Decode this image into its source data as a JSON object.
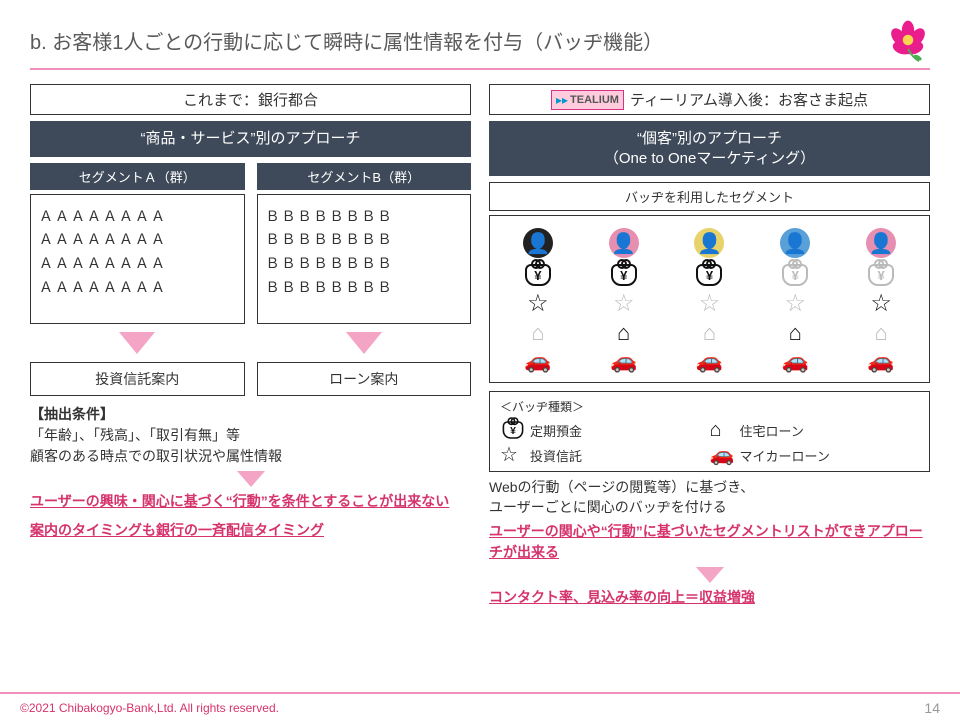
{
  "title": "b. お客様1人ごとの行動に応じて瞬時に属性情報を付与（バッヂ機能）",
  "left": {
    "header": "これまで：銀行都合",
    "approach": "“商品・サービス”別のアプローチ",
    "segments": [
      {
        "name": "セグメントＡ（群）",
        "rows": [
          "ＡＡＡＡＡＡＡＡ",
          "ＡＡＡＡＡＡＡＡ",
          "ＡＡＡＡＡＡＡＡ",
          "ＡＡＡＡＡＡＡＡ"
        ],
        "case": "投資信託案内"
      },
      {
        "name": "セグメントB（群）",
        "rows": [
          "ＢＢＢＢＢＢＢＢ",
          "ＢＢＢＢＢＢＢＢ",
          "ＢＢＢＢＢＢＢＢ",
          "ＢＢＢＢＢＢＢＢ"
        ],
        "case": "ローン案内"
      }
    ],
    "cond_title": "【抽出条件】",
    "cond_body": "「年齢」、「残高」、「取引有無」等\n顧客のある時点での取引状況や属性情報",
    "red1": "ユーザーの興味・関心に基づく“行動”を条件とすることが出来ない",
    "red2": "案内のタイミングも銀行の一斉配信タイミング"
  },
  "right": {
    "tealium_brand": "TEALIUM",
    "header": "ティーリアム導入後：お客さま起点",
    "approach_l1": "“個客”別のアプローチ",
    "approach_l2": "（One to Oneマーケティング）",
    "badge_header": "バッヂを利用したセグメント",
    "heads": [
      "dark",
      "pink",
      "yellow",
      "blue",
      "pink"
    ],
    "yen": [
      "on",
      "on",
      "on",
      "off",
      "off"
    ],
    "star": [
      "on",
      "off",
      "off",
      "off",
      "on"
    ],
    "house": [
      "off",
      "on",
      "off",
      "on",
      "off"
    ],
    "car": [
      "off",
      "off",
      "off",
      "on",
      "on"
    ],
    "legend_title": "＜バッヂ種類＞",
    "legend": {
      "teiki": "定期預金",
      "jutaku": "住宅ローン",
      "toushin": "投資信託",
      "mycar": "マイカーローン"
    },
    "web_note": "Webの行動（ページの閲覧等）に基づき、\nユーザーごとに関心のバッヂを付ける",
    "red1": "ユーザーの関心や“行動”に基づいたセグメントリストができアプローチが出来る",
    "red2": "コンタクト率、見込み率の向上＝収益増強"
  },
  "footer": {
    "copyright": "©2021 Chibakogyo-Bank,Ltd.  All rights reserved.",
    "page": "14"
  }
}
